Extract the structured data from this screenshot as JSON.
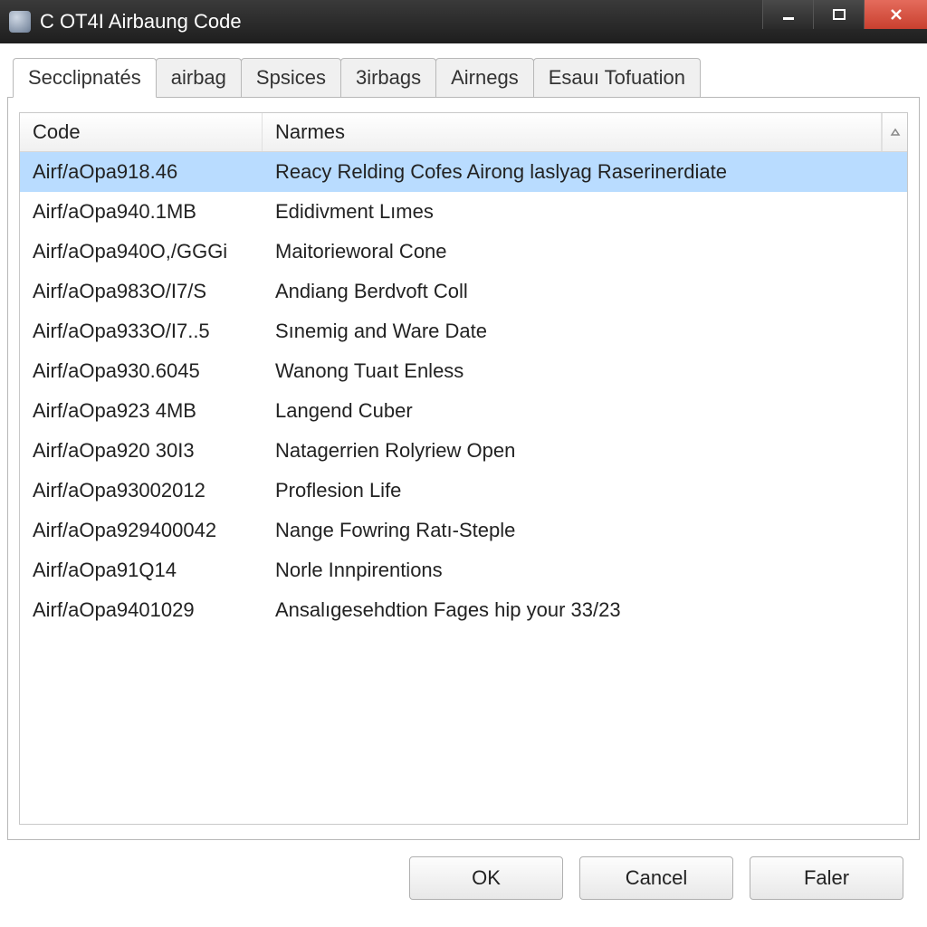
{
  "window": {
    "title": "C OT4I Airbaung Code"
  },
  "tabs": [
    {
      "label": "Secclipnatés",
      "active": true
    },
    {
      "label": "airbag",
      "active": false
    },
    {
      "label": "Spsices",
      "active": false
    },
    {
      "label": "3irbags",
      "active": false
    },
    {
      "label": "Airnegs",
      "active": false
    },
    {
      "label": "Esauı Tofuation",
      "active": false
    }
  ],
  "columns": {
    "code": "Code",
    "names": "Narmes"
  },
  "rows": [
    {
      "code": "Airf/aOpa918.46",
      "name": "Reacy Relding Cofes Airong laslyag Raserinerdiate",
      "selected": true
    },
    {
      "code": "Airf/aOpa940.1MB",
      "name": "Edidivment Lımes",
      "selected": false
    },
    {
      "code": "Airf/aOpa940O,/GGGi",
      "name": "Maitorieworal Cone",
      "selected": false
    },
    {
      "code": "Airf/aOpa983O/I7/S",
      "name": "Andiang Berdvoft Coll",
      "selected": false
    },
    {
      "code": "Airf/aOpa933O/I7..5",
      "name": "Sınemig and Ware Date",
      "selected": false
    },
    {
      "code": "Airf/aOpa930.6045",
      "name": "Wanong Tuaıt Enless",
      "selected": false
    },
    {
      "code": "Airf/aOpa923 4MB",
      "name": "Langend Cuber",
      "selected": false
    },
    {
      "code": "Airf/aOpa920 30I3",
      "name": "Natagerrien Rolyriew Open",
      "selected": false
    },
    {
      "code": "Airf/aOpa93002012",
      "name": "Proflesion Life",
      "selected": false
    },
    {
      "code": "Airf/aOpa929400042",
      "name": "Nange Fowring Ratı-Steple",
      "selected": false
    },
    {
      "code": "Airf/aOpa91Q14",
      "name": "Norle Innpirentions",
      "selected": false
    },
    {
      "code": "Airf/aOpa9401029",
      "name": "Ansalıgesehdtion Fages hip your 33/23",
      "selected": false
    }
  ],
  "buttons": {
    "ok": "OK",
    "cancel": "Cancel",
    "faler": "Faler"
  }
}
